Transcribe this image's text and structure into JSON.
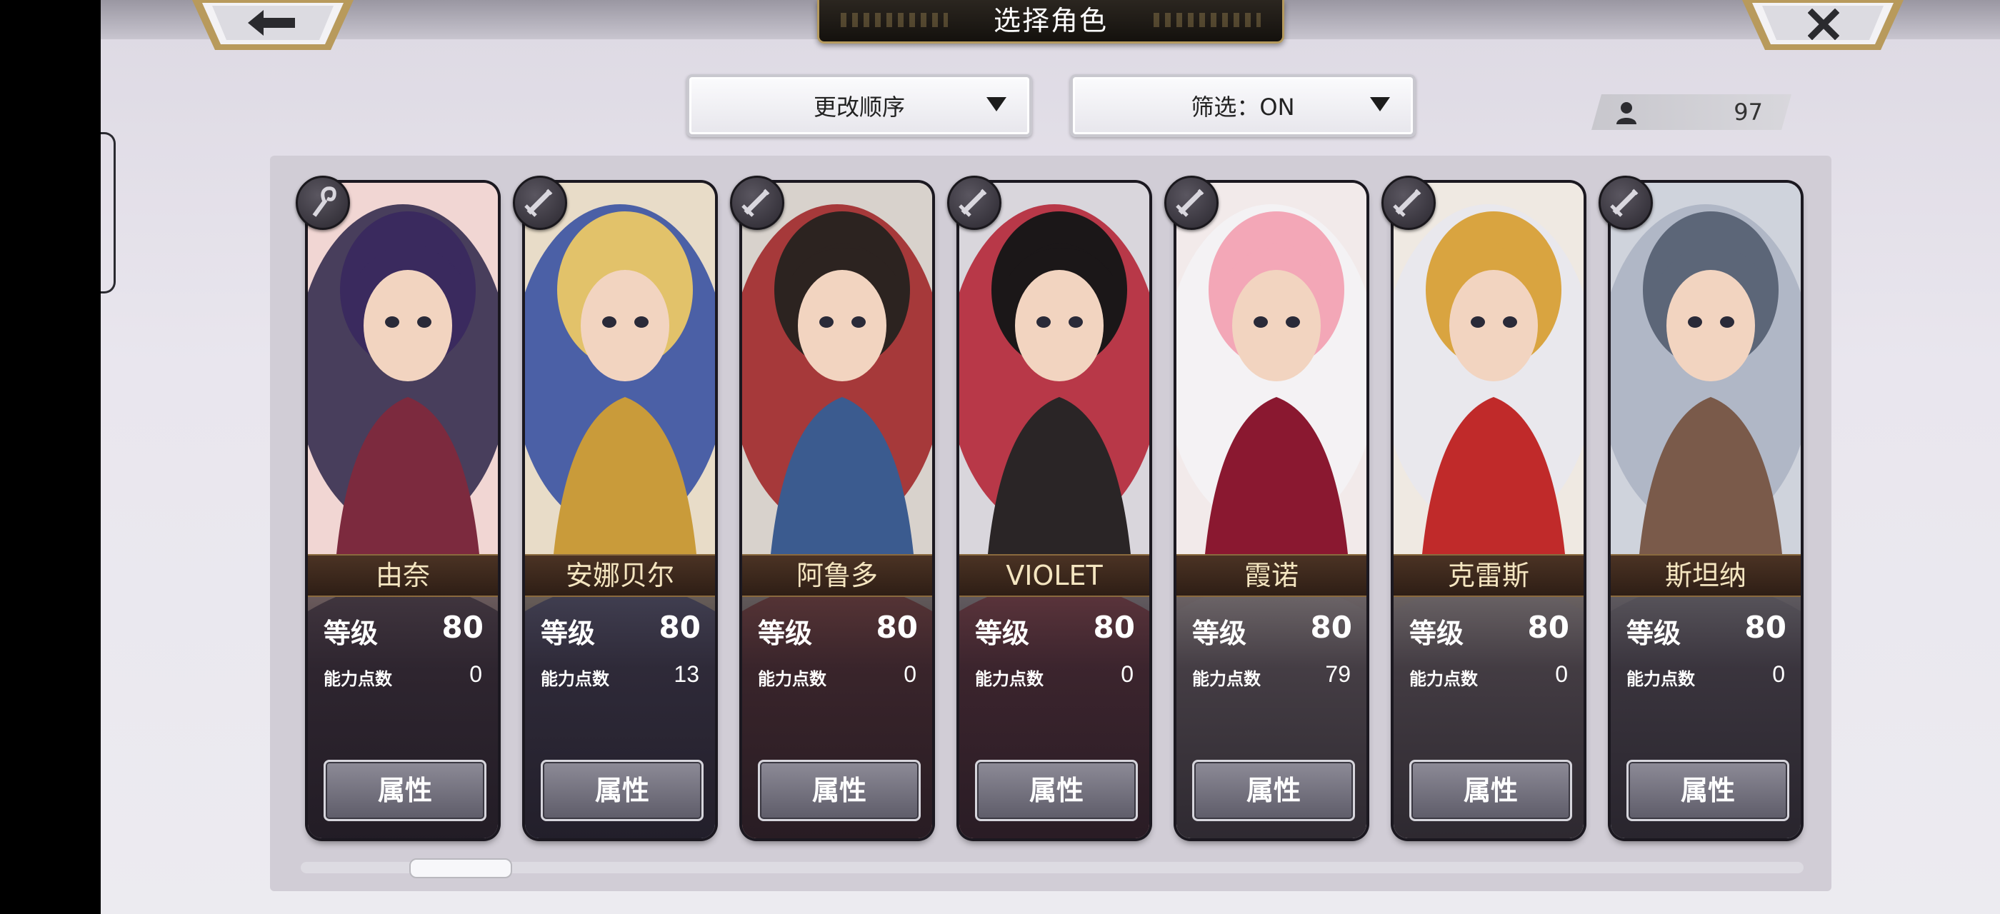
{
  "header": {
    "title": "选择角色",
    "back_icon": "back-arrow-icon",
    "close_icon": "close-x-icon"
  },
  "controls": {
    "sort_label": "更改顺序",
    "filter_label": "筛选：ON",
    "character_count": "97"
  },
  "characters": [
    {
      "name": "由奈",
      "level_label": "等级",
      "level": "80",
      "points_label": "能力点数",
      "points": "0",
      "button": "属性",
      "weapon_icon": "staff-icon"
    },
    {
      "name": "安娜贝尔",
      "level_label": "等级",
      "level": "80",
      "points_label": "能力点数",
      "points": "13",
      "button": "属性",
      "weapon_icon": "sword-icon"
    },
    {
      "name": "阿鲁多",
      "level_label": "等级",
      "level": "80",
      "points_label": "能力点数",
      "points": "0",
      "button": "属性",
      "weapon_icon": "sword-icon"
    },
    {
      "name": "VIOLET",
      "level_label": "等级",
      "level": "80",
      "points_label": "能力点数",
      "points": "0",
      "button": "属性",
      "weapon_icon": "sword-icon"
    },
    {
      "name": "霞诺",
      "level_label": "等级",
      "level": "80",
      "points_label": "能力点数",
      "points": "79",
      "button": "属性",
      "weapon_icon": "sword-icon"
    },
    {
      "name": "克雷斯",
      "level_label": "等级",
      "level": "80",
      "points_label": "能力点数",
      "points": "0",
      "button": "属性",
      "weapon_icon": "sword-icon"
    },
    {
      "name": "斯坦纳",
      "level_label": "等级",
      "level": "80",
      "points_label": "能力点数",
      "points": "0",
      "button": "属性",
      "weapon_icon": "sword-icon"
    }
  ],
  "colors": {
    "name_text": "#f4e5c0",
    "gold_trim": "#b59a5e"
  }
}
